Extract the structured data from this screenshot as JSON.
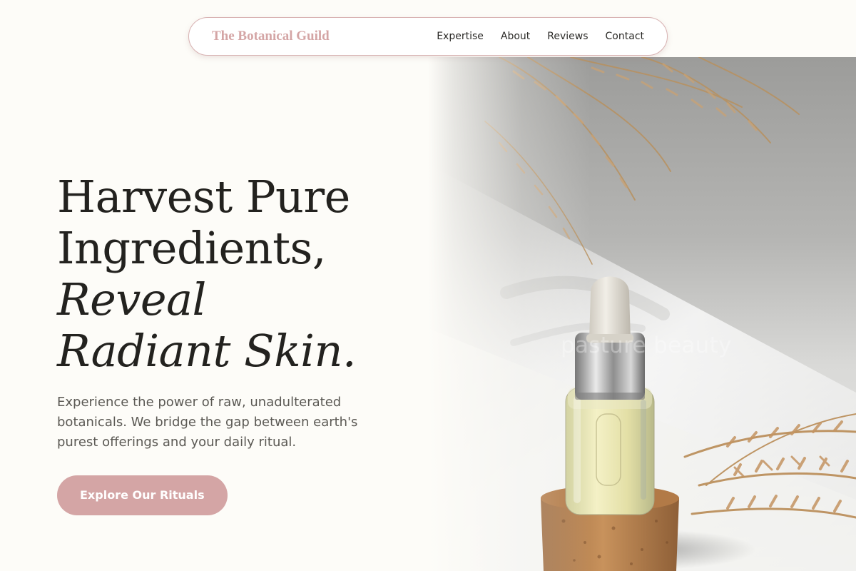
{
  "nav": {
    "brand": "The Botanical Guild",
    "links": [
      "Expertise",
      "About",
      "Reviews",
      "Contact"
    ]
  },
  "hero": {
    "headline_line1": "Harvest Pure",
    "headline_line2": "Ingredients,",
    "headline_line3": "Reveal",
    "headline_line4": "Radiant Skin.",
    "subtext": "Experience the power of raw, unadulterated botanicals. We bridge the gap between earth's purest offerings and your daily ritual.",
    "cta_label": "Explore Our Rituals",
    "image_watermark": "pasture beauty"
  },
  "colors": {
    "accent": "#d4a5a5",
    "background": "#fdfcf8",
    "heading": "#23221f",
    "body_text": "#5b5954"
  },
  "icons": []
}
